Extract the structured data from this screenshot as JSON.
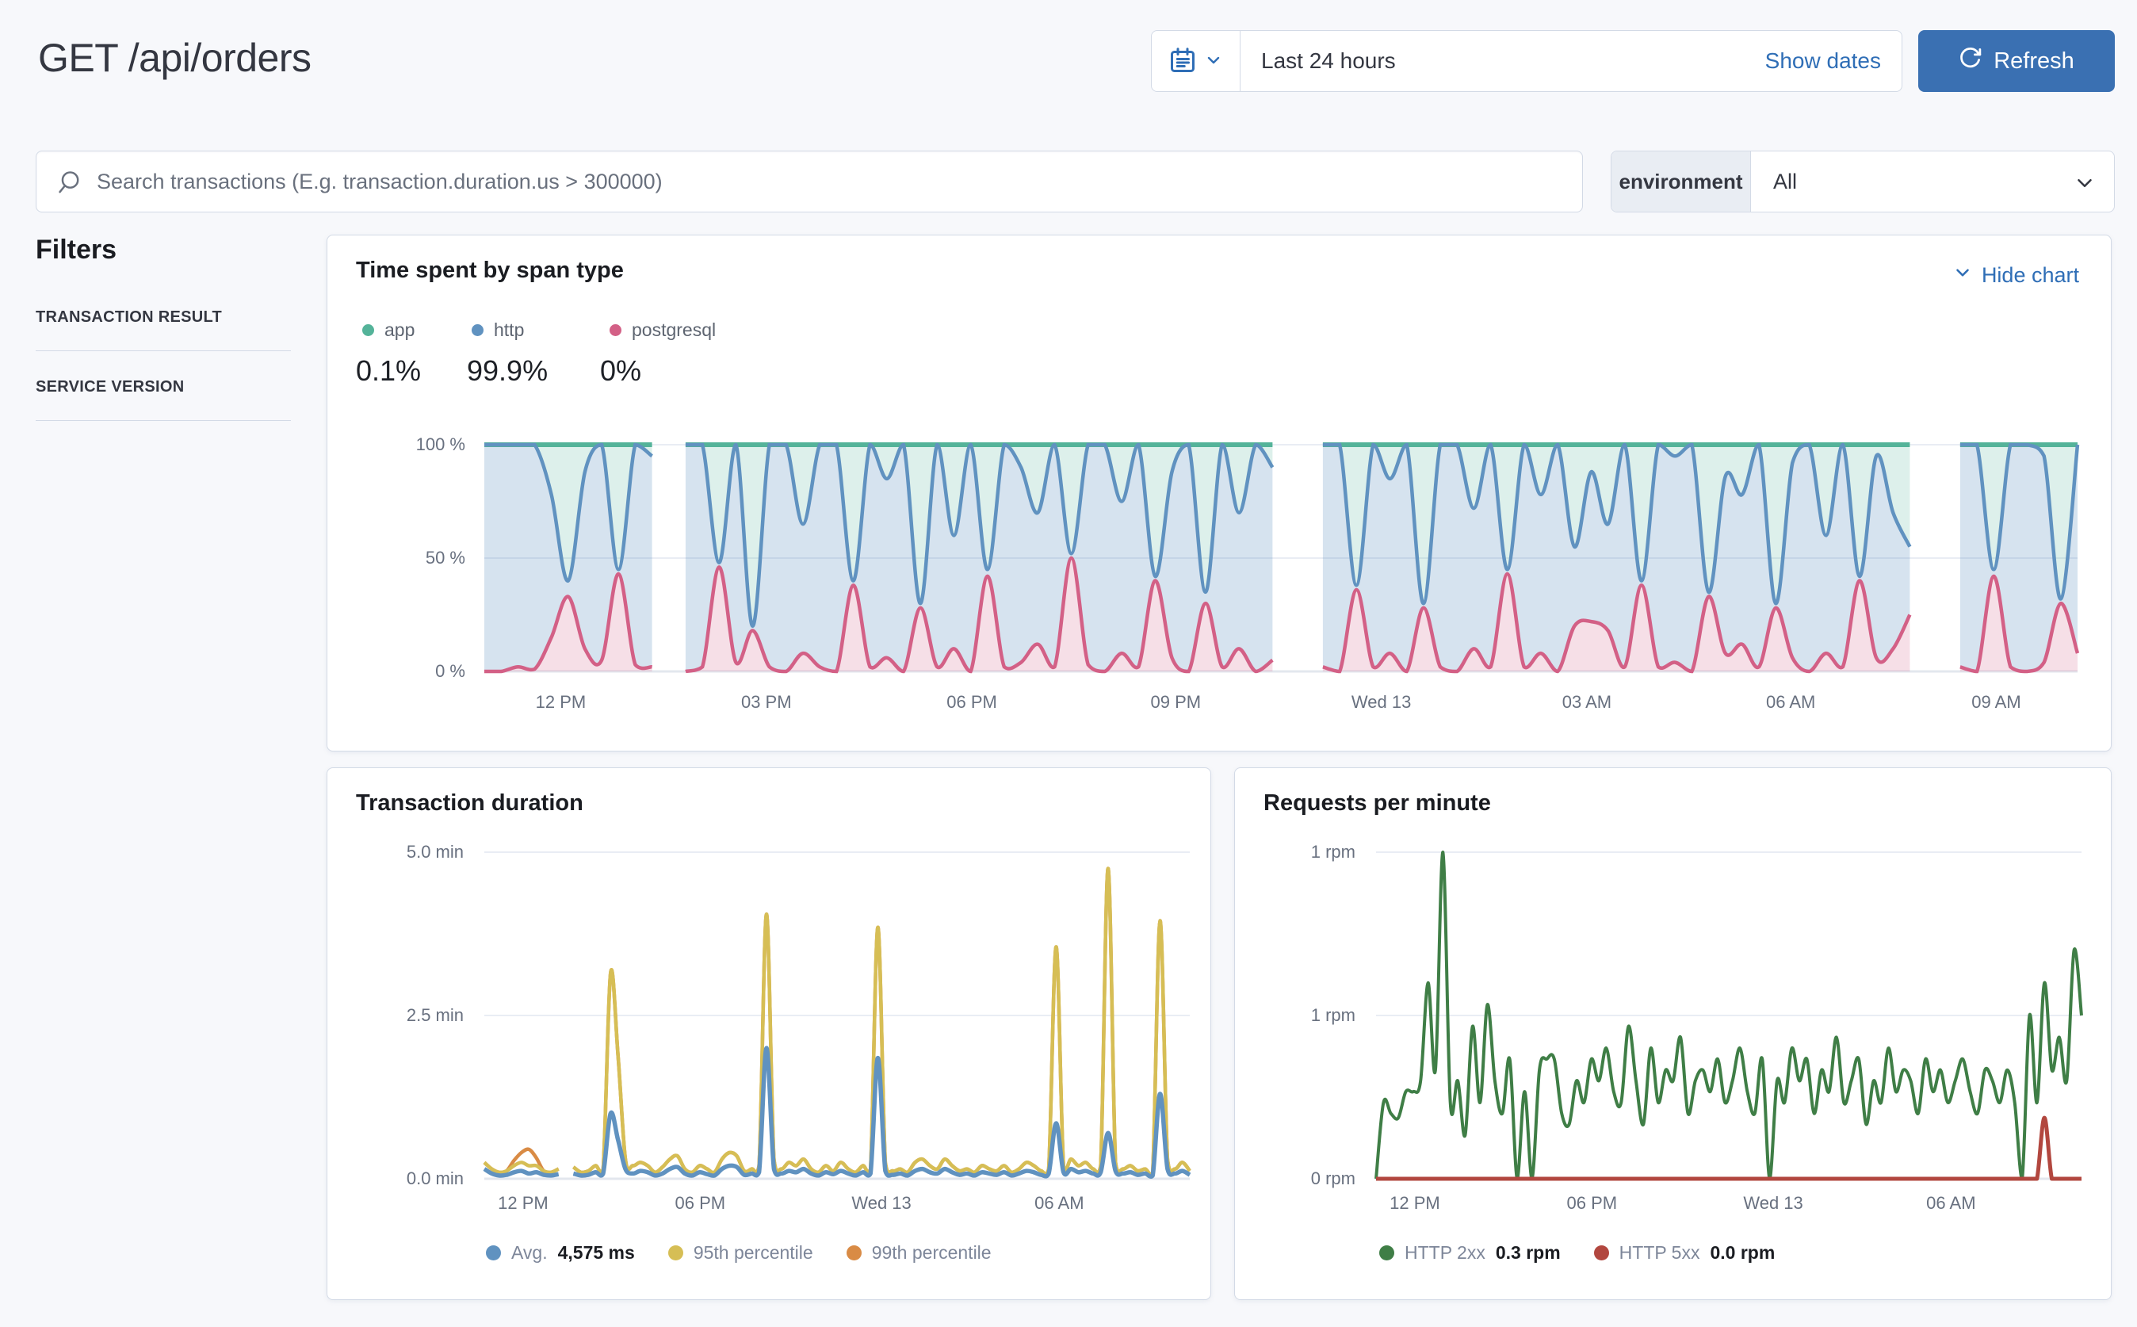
{
  "page": {
    "title": "GET /api/orders"
  },
  "toolbar": {
    "time_range": "Last 24 hours",
    "show_dates_label": "Show dates",
    "refresh_label": "Refresh"
  },
  "search": {
    "placeholder": "Search transactions (E.g. transaction.duration.us > 300000)"
  },
  "environment_filter": {
    "label": "environment",
    "value": "All"
  },
  "filters": {
    "heading": "Filters",
    "sections": [
      "TRANSACTION RESULT",
      "SERVICE VERSION"
    ]
  },
  "span_panel": {
    "hide_chart_label": "Hide chart"
  },
  "chart_data": [
    {
      "type": "area",
      "title": "Time spent by span type",
      "stacked_percent": true,
      "ylim": [
        0,
        100
      ],
      "y_ticks": [
        {
          "label": "100 %",
          "value": 100
        },
        {
          "label": "50 %",
          "value": 50
        },
        {
          "label": "0 %",
          "value": 0
        }
      ],
      "x_labels": [
        "12 PM",
        "03 PM",
        "06 PM",
        "09 PM",
        "Wed 13",
        "03 AM",
        "06 AM",
        "09 AM"
      ],
      "x_label_fractions": [
        0.048,
        0.177,
        0.306,
        0.434,
        0.563,
        0.692,
        0.82,
        0.949
      ],
      "legend": [
        {
          "label": "app",
          "value": "0.1%"
        },
        {
          "label": "http",
          "value": "99.9%"
        },
        {
          "label": "postgresql",
          "value": "0%"
        }
      ],
      "series": [
        {
          "name": "postgresql",
          "color": "#d36086",
          "stack_top_percent": [
            0,
            0,
            2,
            1,
            15,
            33,
            10,
            5,
            43,
            3,
            2,
            null,
            0,
            2,
            46,
            4,
            18,
            2,
            0,
            8,
            2,
            0,
            38,
            2,
            6,
            0,
            28,
            2,
            10,
            0,
            42,
            2,
            4,
            12,
            2,
            50,
            3,
            0,
            8,
            2,
            40,
            6,
            0,
            30,
            2,
            10,
            0,
            5,
            null,
            null,
            2,
            0,
            36,
            2,
            8,
            0,
            28,
            2,
            0,
            10,
            2,
            43,
            2,
            8,
            0,
            20,
            22,
            18,
            2,
            38,
            2,
            4,
            0,
            33,
            8,
            12,
            2,
            28,
            6,
            0,
            8,
            2,
            40,
            6,
            10,
            25,
            null,
            null,
            2,
            0,
            42,
            2,
            0,
            4,
            30,
            8
          ]
        },
        {
          "name": "http",
          "color": "#6092c0",
          "stack_top_percent": [
            100,
            100,
            100,
            100,
            78,
            40,
            88,
            100,
            45,
            100,
            95,
            null,
            100,
            100,
            48,
            100,
            20,
            100,
            100,
            65,
            100,
            100,
            40,
            100,
            85,
            100,
            30,
            100,
            60,
            100,
            45,
            100,
            90,
            70,
            100,
            52,
            100,
            100,
            75,
            100,
            42,
            88,
            100,
            35,
            100,
            70,
            100,
            90,
            null,
            null,
            100,
            100,
            38,
            100,
            85,
            100,
            30,
            100,
            100,
            72,
            100,
            45,
            100,
            78,
            100,
            55,
            88,
            65,
            100,
            40,
            100,
            95,
            100,
            35,
            86,
            78,
            100,
            30,
            92,
            100,
            60,
            100,
            42,
            95,
            70,
            55,
            null,
            null,
            100,
            100,
            45,
            100,
            100,
            95,
            32,
            100
          ]
        },
        {
          "name": "app",
          "color": "#54b399",
          "stack_top_percent": [
            100,
            100,
            100,
            100,
            100,
            100,
            100,
            100,
            100,
            100,
            100,
            null,
            100,
            100,
            100,
            100,
            100,
            100,
            100,
            100,
            100,
            100,
            100,
            100,
            100,
            100,
            100,
            100,
            100,
            100,
            100,
            100,
            100,
            100,
            100,
            100,
            100,
            100,
            100,
            100,
            100,
            100,
            100,
            100,
            100,
            100,
            100,
            100,
            null,
            null,
            100,
            100,
            100,
            100,
            100,
            100,
            100,
            100,
            100,
            100,
            100,
            100,
            100,
            100,
            100,
            100,
            100,
            100,
            100,
            100,
            100,
            100,
            100,
            100,
            100,
            100,
            100,
            100,
            100,
            100,
            100,
            100,
            100,
            100,
            100,
            100,
            null,
            null,
            100,
            100,
            100,
            100,
            100,
            100,
            100,
            100
          ]
        }
      ]
    },
    {
      "type": "line",
      "title": "Transaction duration",
      "ylabel": "minutes",
      "ylim": [
        0,
        5
      ],
      "y_ticks": [
        {
          "label": "5.0 min",
          "value": 5
        },
        {
          "label": "2.5 min",
          "value": 2.5
        },
        {
          "label": "0.0 min",
          "value": 0
        }
      ],
      "x_labels": [
        "12 PM",
        "06 PM",
        "Wed 13",
        "06 AM"
      ],
      "x_label_fractions": [
        0.055,
        0.306,
        0.563,
        0.815
      ],
      "legend": [
        {
          "label": "Avg.",
          "value": "4,575 ms"
        },
        {
          "label": "95th percentile",
          "value": ""
        },
        {
          "label": "99th percentile",
          "value": ""
        }
      ],
      "series": [
        {
          "name": "99th percentile",
          "color": "#d98b45",
          "values": [
            0.25,
            0.15,
            0.1,
            0.12,
            0.28,
            0.4,
            0.45,
            0.32,
            0.12,
            0.1,
            0.15,
            null,
            0.18,
            0.1,
            0.12,
            0.2,
            0.15,
            3.15,
            1.9,
            0.3,
            0.2,
            0.25,
            0.2,
            0.1,
            0.18,
            0.3,
            0.35,
            0.15,
            0.1,
            0.2,
            0.15,
            0.1,
            0.3,
            0.4,
            0.35,
            0.12,
            0.15,
            0.2,
            4.05,
            0.3,
            0.15,
            0.25,
            0.2,
            0.3,
            0.15,
            0.1,
            0.2,
            0.12,
            0.25,
            0.15,
            0.1,
            0.2,
            0.15,
            3.85,
            0.25,
            0.12,
            0.15,
            0.1,
            0.25,
            0.3,
            0.2,
            0.15,
            0.3,
            0.2,
            0.12,
            0.15,
            0.1,
            0.2,
            0.15,
            0.12,
            0.2,
            0.1,
            0.15,
            0.25,
            0.2,
            0.12,
            0.15,
            3.55,
            0.2,
            0.3,
            0.2,
            0.25,
            0.15,
            0.2,
            4.75,
            0.25,
            0.15,
            0.2,
            0.12,
            0.15,
            0.1,
            3.95,
            0.3,
            0.15,
            0.25,
            0.12
          ]
        },
        {
          "name": "95th percentile",
          "color": "#d6be55",
          "values": [
            0.25,
            0.15,
            0.1,
            0.12,
            0.2,
            0.25,
            0.2,
            0.2,
            0.12,
            0.1,
            0.15,
            null,
            0.18,
            0.1,
            0.12,
            0.2,
            0.15,
            3.15,
            1.9,
            0.3,
            0.2,
            0.25,
            0.2,
            0.1,
            0.18,
            0.3,
            0.35,
            0.15,
            0.1,
            0.2,
            0.15,
            0.1,
            0.3,
            0.4,
            0.35,
            0.12,
            0.15,
            0.2,
            4.05,
            0.3,
            0.15,
            0.25,
            0.2,
            0.3,
            0.15,
            0.1,
            0.2,
            0.12,
            0.25,
            0.15,
            0.1,
            0.2,
            0.15,
            3.85,
            0.25,
            0.12,
            0.15,
            0.1,
            0.25,
            0.3,
            0.2,
            0.15,
            0.3,
            0.2,
            0.12,
            0.15,
            0.1,
            0.2,
            0.15,
            0.12,
            0.2,
            0.1,
            0.15,
            0.25,
            0.2,
            0.12,
            0.15,
            3.55,
            0.2,
            0.3,
            0.2,
            0.25,
            0.15,
            0.2,
            4.75,
            0.25,
            0.15,
            0.2,
            0.12,
            0.15,
            0.1,
            3.95,
            0.3,
            0.15,
            0.25,
            0.12
          ]
        },
        {
          "name": "Avg.",
          "color": "#6092c0",
          "values": [
            0.15,
            0.08,
            0.05,
            0.06,
            0.1,
            0.12,
            0.08,
            0.1,
            0.06,
            0.05,
            0.07,
            null,
            0.08,
            0.05,
            0.06,
            0.1,
            0.08,
            1.0,
            0.6,
            0.15,
            0.08,
            0.12,
            0.1,
            0.05,
            0.08,
            0.15,
            0.18,
            0.08,
            0.05,
            0.1,
            0.07,
            0.05,
            0.15,
            0.2,
            0.18,
            0.06,
            0.08,
            0.1,
            2.0,
            0.15,
            0.08,
            0.12,
            0.1,
            0.15,
            0.08,
            0.05,
            0.1,
            0.07,
            0.12,
            0.08,
            0.05,
            0.1,
            0.08,
            1.85,
            0.12,
            0.06,
            0.08,
            0.05,
            0.12,
            0.15,
            0.1,
            0.08,
            0.15,
            0.1,
            0.06,
            0.08,
            0.05,
            0.1,
            0.08,
            0.06,
            0.1,
            0.05,
            0.08,
            0.12,
            0.1,
            0.06,
            0.08,
            0.85,
            0.1,
            0.15,
            0.1,
            0.12,
            0.08,
            0.1,
            0.7,
            0.12,
            0.08,
            0.1,
            0.06,
            0.08,
            0.05,
            1.3,
            0.15,
            0.08,
            0.12,
            0.06
          ]
        }
      ]
    },
    {
      "type": "line",
      "title": "Requests per minute",
      "ylabel": "rpm",
      "ylim": [
        0,
        1.5
      ],
      "y_ticks": [
        {
          "label": "1 rpm",
          "value": 1.5
        },
        {
          "label": "1 rpm",
          "value": 0.75
        },
        {
          "label": "0 rpm",
          "value": 0
        }
      ],
      "x_labels": [
        "12 PM",
        "06 PM",
        "Wed 13",
        "06 AM"
      ],
      "x_label_fractions": [
        0.055,
        0.306,
        0.563,
        0.815
      ],
      "legend": [
        {
          "label": "HTTP 2xx",
          "value": "0.3 rpm"
        },
        {
          "label": "HTTP 5xx",
          "value": "0.0 rpm"
        }
      ],
      "series": [
        {
          "name": "HTTP 2xx",
          "color": "#3f7e46",
          "values": [
            0,
            0.35,
            0.3,
            0.28,
            0.4,
            0.4,
            0.45,
            0.9,
            0.5,
            1.5,
            0.35,
            0.45,
            0.2,
            0.7,
            0.35,
            0.8,
            0.45,
            0.3,
            0.55,
            0,
            0.4,
            0,
            0.5,
            0.55,
            0.55,
            0.3,
            0.25,
            0.45,
            0.35,
            0.55,
            0.45,
            0.6,
            0.4,
            0.35,
            0.7,
            0.45,
            0.25,
            0.6,
            0.35,
            0.5,
            0.45,
            0.65,
            0.3,
            0.45,
            0.5,
            0.4,
            0.55,
            0.35,
            0.45,
            0.6,
            0.4,
            0.3,
            0.55,
            0,
            0.45,
            0.35,
            0.6,
            0.45,
            0.55,
            0.3,
            0.5,
            0.4,
            0.65,
            0.35,
            0.45,
            0.55,
            0.25,
            0.45,
            0.35,
            0.6,
            0.4,
            0.5,
            0.45,
            0.3,
            0.55,
            0.4,
            0.5,
            0.35,
            0.45,
            0.55,
            0.4,
            0.3,
            0.5,
            0.45,
            0.35,
            0.5,
            0.35,
            0,
            0.75,
            0.35,
            0.9,
            0.5,
            0.65,
            0.45,
            1.05,
            0.75
          ]
        },
        {
          "name": "HTTP 5xx",
          "color": "#b2473f",
          "values": [
            0,
            0,
            0,
            0,
            0,
            0,
            0,
            0,
            0,
            0,
            0,
            0,
            0,
            0,
            0,
            0,
            0,
            0,
            0,
            0,
            0,
            0,
            0,
            0,
            0,
            0,
            0,
            0,
            0,
            0,
            0,
            0,
            0,
            0,
            0,
            0,
            0,
            0,
            0,
            0,
            0,
            0,
            0,
            0,
            0,
            0,
            0,
            0,
            0,
            0,
            0,
            0,
            0,
            0,
            0,
            0,
            0,
            0,
            0,
            0,
            0,
            0,
            0,
            0,
            0,
            0,
            0,
            0,
            0,
            0,
            0,
            0,
            0,
            0,
            0,
            0,
            0,
            0,
            0,
            0,
            0,
            0,
            0,
            0,
            0,
            0,
            0,
            0,
            0,
            0,
            0.28,
            0,
            0,
            0,
            0,
            0
          ]
        }
      ]
    }
  ]
}
